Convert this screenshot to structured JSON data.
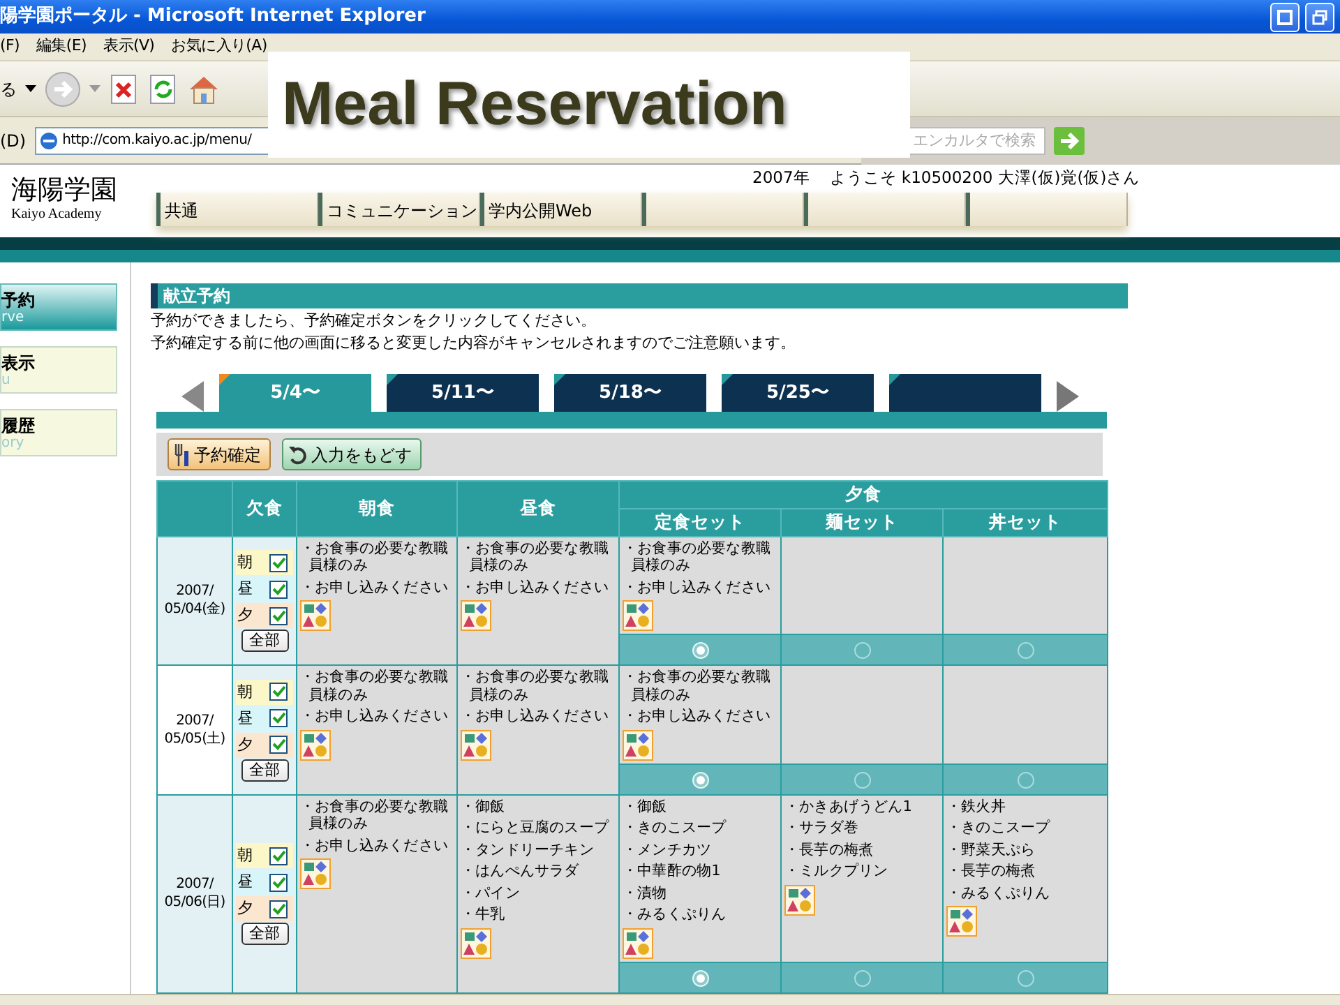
{
  "window": {
    "title": "陽学園ポータル - Microsoft Internet Explorer"
  },
  "menu_bar": [
    "(F)",
    "編集(E)",
    "表示(V)",
    "お気に入り(A)"
  ],
  "toolbar": {
    "back_label": "る"
  },
  "address_bar": {
    "label": "(D)",
    "url": "http://com.kaiyo.ac.jp/menu/"
  },
  "search": {
    "placeholder": "エンカルタで検索"
  },
  "overlay_title": "Meal Reservation",
  "site": {
    "logo": "海陽学園",
    "logo_sub": "Kaiyo Academy",
    "year": "2007年",
    "welcome": "ようこそ k10500200 大澤(仮)覚(仮)さん",
    "nav": [
      {
        "kind": "label",
        "label": "共通"
      },
      {
        "kind": "label",
        "label": "コミュニケーション"
      },
      {
        "kind": "label",
        "label": "学内公開Web"
      },
      {
        "kind": "blank"
      },
      {
        "kind": "blank"
      },
      {
        "kind": "blank"
      }
    ]
  },
  "sidebar": [
    {
      "label": "予約",
      "sub": "rve",
      "selected": true
    },
    {
      "label": "表示",
      "sub": "u",
      "selected": false
    },
    {
      "label": "履歴",
      "sub": "ory",
      "selected": false
    }
  ],
  "section_title": "献立予約",
  "instructions": [
    "予約ができましたら、予約確定ボタンをクリックしてください。",
    "予約確定する前に他の画面に移ると変更した内容がキャンセルされますのでご注意願います。"
  ],
  "week_tabs": [
    {
      "kind": "label",
      "label": "5/4〜",
      "selected": true
    },
    {
      "kind": "label",
      "label": "5/11〜",
      "selected": false
    },
    {
      "kind": "label",
      "label": "5/18〜",
      "selected": false
    },
    {
      "kind": "label",
      "label": "5/25〜",
      "selected": false
    },
    {
      "kind": "blank",
      "selected": false
    }
  ],
  "actions": [
    {
      "kind": "confirm",
      "label": "予約確定"
    },
    {
      "kind": "reset",
      "label": "入力をもどす"
    }
  ],
  "table": {
    "headers": {
      "skip": "欠食",
      "breakfast": "朝食",
      "lunch": "昼食",
      "dinner": "夕食",
      "dinner_sets": [
        "定食セット",
        "麺セット",
        "丼セット"
      ]
    },
    "rows": [
      {
        "year": "2007/",
        "day": "05/04(金)",
        "shaded": true,
        "skip": [
          {
            "label": "朝",
            "checked": true
          },
          {
            "label": "昼",
            "checked": true
          },
          {
            "label": "夕",
            "checked": true
          }
        ],
        "all_button": "全部",
        "breakfast": [
          "・お食事の必要な教職員様のみ",
          "・お申し込みください"
        ],
        "lunch": [
          "・お食事の必要な教職員様のみ",
          "・お申し込みください"
        ],
        "dinner": [
          {
            "items": [
              "・お食事の必要な教職員様のみ",
              "・お申し込みください"
            ],
            "selected": true
          },
          {
            "selected": false
          },
          {
            "selected": false
          }
        ]
      },
      {
        "year": "2007/",
        "day": "05/05(土)",
        "shaded": false,
        "skip": [
          {
            "label": "朝",
            "checked": true
          },
          {
            "label": "昼",
            "checked": true
          },
          {
            "label": "夕",
            "checked": true
          }
        ],
        "all_button": "全部",
        "breakfast": [
          "・お食事の必要な教職員様のみ",
          "・お申し込みください"
        ],
        "lunch": [
          "・お食事の必要な教職員様のみ",
          "・お申し込みください"
        ],
        "dinner": [
          {
            "items": [
              "・お食事の必要な教職員様のみ",
              "・お申し込みください"
            ],
            "selected": true
          },
          {
            "selected": false
          },
          {
            "selected": false
          }
        ]
      },
      {
        "year": "2007/",
        "day": "05/06(日)",
        "shaded": true,
        "skip": [
          {
            "label": "朝",
            "checked": true
          },
          {
            "label": "昼",
            "checked": true
          },
          {
            "label": "夕",
            "checked": true
          }
        ],
        "all_button": "全部",
        "breakfast": [
          "・お食事の必要な教職員様のみ",
          "・お申し込みください"
        ],
        "lunch": [
          "・御飯",
          "・にらと豆腐のスープ",
          "・タンドリーチキン",
          "・はんぺんサラダ",
          "・パイン",
          "・牛乳"
        ],
        "dinner": [
          {
            "items": [
              "・御飯",
              "・きのこスープ",
              "・メンチカツ",
              "・中華酢の物1",
              "・漬物",
              "・みるくぷりん"
            ],
            "selected": true
          },
          {
            "items": [
              "・かきあげうどん1",
              "・サラダ巻",
              "・長芋の梅煮",
              "・ミルクプリン"
            ],
            "selected": false
          },
          {
            "items": [
              "・鉄火丼",
              "・きのこスープ",
              "・野菜天ぷら",
              "・長芋の梅煮",
              "・みるくぷりん"
            ],
            "selected": false
          }
        ]
      }
    ]
  }
}
